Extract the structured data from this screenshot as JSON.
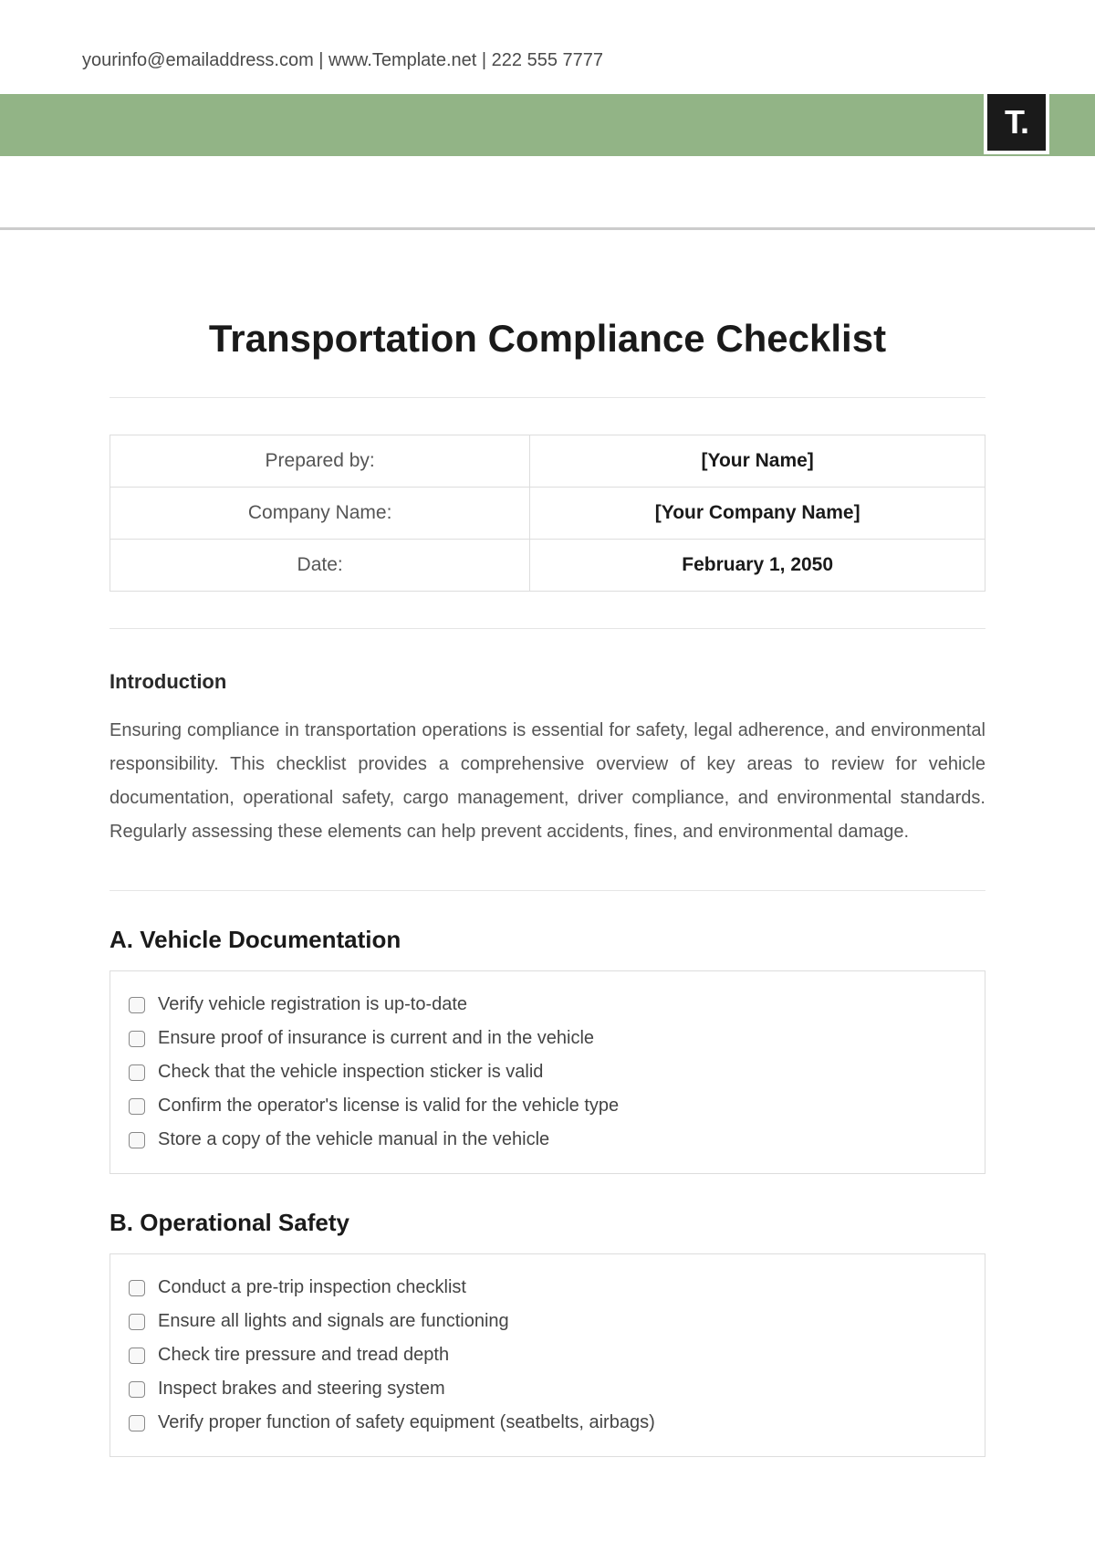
{
  "header": {
    "contact": "yourinfo@emailaddress.com  |  www.Template.net  |  222 555 7777"
  },
  "logo": {
    "text": "T."
  },
  "document": {
    "title": "Transportation Compliance Checklist"
  },
  "infoTable": {
    "rows": [
      {
        "label": "Prepared by:",
        "value": "[Your Name]"
      },
      {
        "label": "Company Name:",
        "value": "[Your Company Name]"
      },
      {
        "label": "Date:",
        "value": "February 1, 2050"
      }
    ]
  },
  "introduction": {
    "heading": "Introduction",
    "text": "Ensuring compliance in transportation operations is essential for safety, legal adherence, and environmental responsibility. This checklist provides a comprehensive overview of key areas to review for vehicle documentation, operational safety, cargo management, driver compliance, and environmental standards. Regularly assessing these elements can help prevent accidents, fines, and environmental damage."
  },
  "sections": [
    {
      "heading": "A. Vehicle Documentation",
      "items": [
        "Verify vehicle registration is up-to-date",
        "Ensure proof of insurance is current and in the vehicle",
        "Check that the vehicle inspection sticker is valid",
        "Confirm the operator's license is valid for the vehicle type",
        "Store a copy of the vehicle manual in the vehicle"
      ]
    },
    {
      "heading": "B. Operational Safety",
      "items": [
        "Conduct a pre-trip inspection checklist",
        "Ensure all lights and signals are functioning",
        "Check tire pressure and tread depth",
        "Inspect brakes and steering system",
        "Verify proper function of safety equipment (seatbelts, airbags)"
      ]
    }
  ]
}
